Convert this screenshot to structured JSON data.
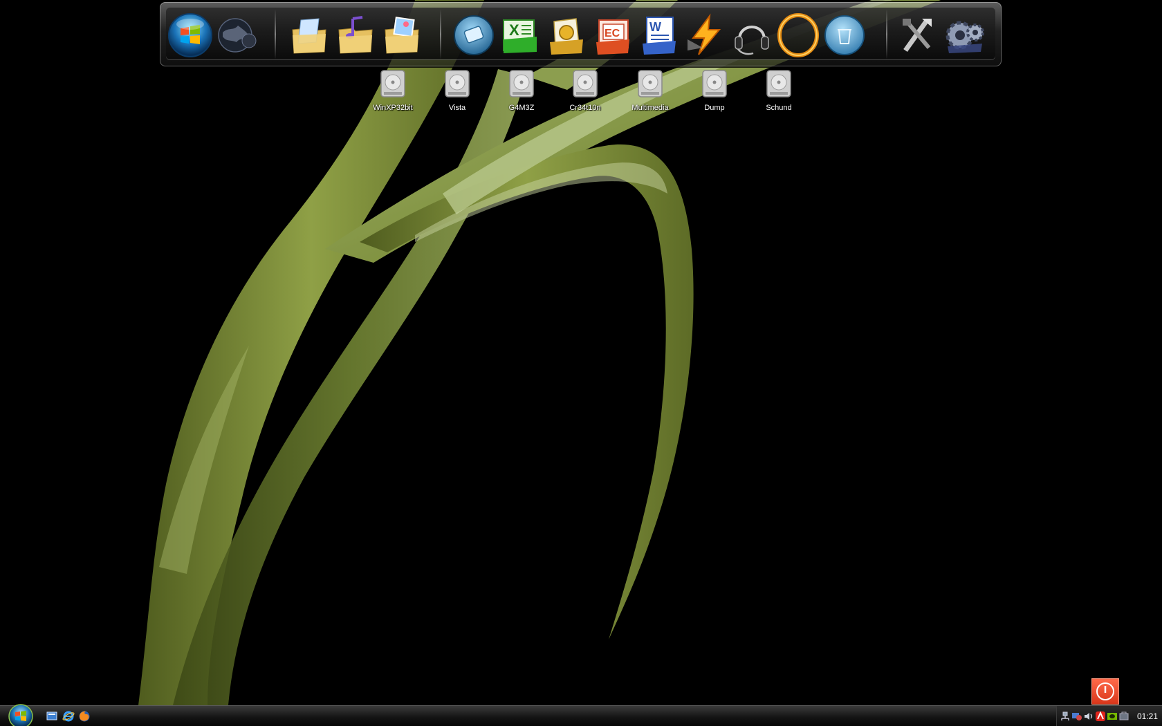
{
  "desktop": {
    "wallpaper": "green-tulip-leaf-on-black",
    "colors": {
      "leaf": "#7c8f3a",
      "leaf_light": "#a8b86a",
      "background": "#000000"
    }
  },
  "dock": {
    "items": [
      {
        "id": "start",
        "icon": "windows-orb-icon"
      },
      {
        "id": "network",
        "icon": "globe-icon"
      },
      {
        "id": "documents",
        "icon": "documents-folder-icon"
      },
      {
        "id": "music",
        "icon": "music-folder-icon"
      },
      {
        "id": "pictures",
        "icon": "pictures-folder-icon"
      },
      {
        "id": "media-player",
        "icon": "media-player-icon"
      },
      {
        "id": "excel",
        "icon": "excel-icon"
      },
      {
        "id": "outlook",
        "icon": "outlook-icon"
      },
      {
        "id": "powerpoint",
        "icon": "powerpoint-icon"
      },
      {
        "id": "word",
        "icon": "word-icon"
      },
      {
        "id": "winamp",
        "icon": "winamp-icon"
      },
      {
        "id": "voice-chat",
        "icon": "headset-icon"
      },
      {
        "id": "ring",
        "icon": "gold-ring-icon"
      },
      {
        "id": "recycle-bin",
        "icon": "recycle-bin-icon"
      },
      {
        "id": "tools",
        "icon": "tools-icon"
      },
      {
        "id": "settings",
        "icon": "gears-icon"
      }
    ]
  },
  "drives": [
    {
      "label": "WinXP32bit"
    },
    {
      "label": "Vista"
    },
    {
      "label": "G4M3Z"
    },
    {
      "label": "Cr34t10n"
    },
    {
      "label": "Multimedia"
    },
    {
      "label": "Dump"
    },
    {
      "label": "Schund"
    }
  ],
  "taskbar": {
    "quick_launch": [
      "show-desktop-icon",
      "internet-explorer-icon",
      "firefox-icon"
    ],
    "tray_icons": [
      "network-icon",
      "messenger-icon",
      "audio-icon",
      "avira-icon",
      "nvidia-icon",
      "safely-remove-icon"
    ],
    "clock": "01:21"
  }
}
